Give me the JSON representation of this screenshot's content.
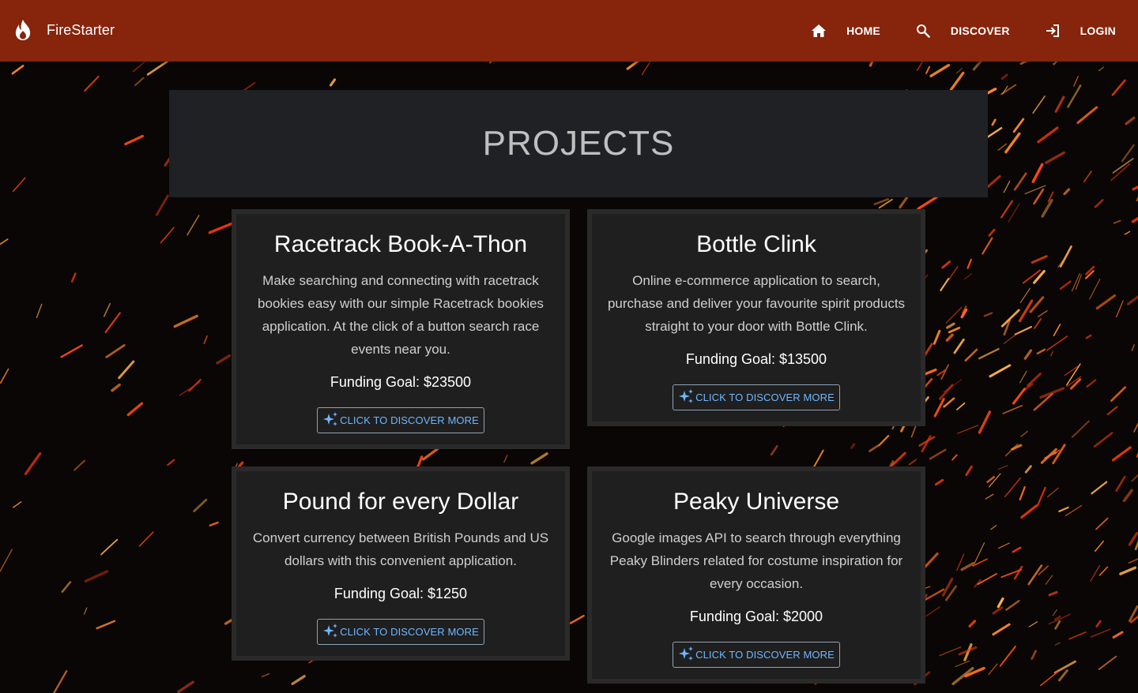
{
  "brand": {
    "name": "FireStarter",
    "icon": "flame-icon"
  },
  "nav": {
    "home": {
      "label": "HOME",
      "icon": "home-icon"
    },
    "discover": {
      "label": "DISCOVER",
      "icon": "search-icon"
    },
    "login": {
      "label": "LOGIN",
      "icon": "login-icon"
    }
  },
  "page": {
    "title": "PROJECTS"
  },
  "projects": [
    {
      "title": "Racetrack Book-A-Thon",
      "description": "Make searching and connecting with racetrack bookies easy with our simple Racetrack bookies application. At the click of a button search race events near you.",
      "funding": "Funding Goal: $23500",
      "button": "CLICK TO DISCOVER MORE"
    },
    {
      "title": "Bottle Clink",
      "description": "Online e-commerce application to search, purchase and deliver your favourite spirit products straight to your door with Bottle Clink.",
      "funding": "Funding Goal: $13500",
      "button": "CLICK TO DISCOVER MORE"
    },
    {
      "title": "Pound for every Dollar",
      "description": "Convert currency between British Pounds and US dollars with this convenient application.",
      "funding": "Funding Goal: $1250",
      "button": "CLICK TO DISCOVER MORE"
    },
    {
      "title": "Peaky Universe",
      "description": "Google images API to search through everything Peaky Blinders related for costume inspiration for every occasion.",
      "funding": "Funding Goal: $2000",
      "button": "CLICK TO DISCOVER MORE"
    }
  ],
  "colors": {
    "topbar": "#86240c",
    "card": "#1f1f1f",
    "banner": "#1f2124",
    "button_text": "#6fb7ff",
    "spark": "#ff5a1a"
  }
}
